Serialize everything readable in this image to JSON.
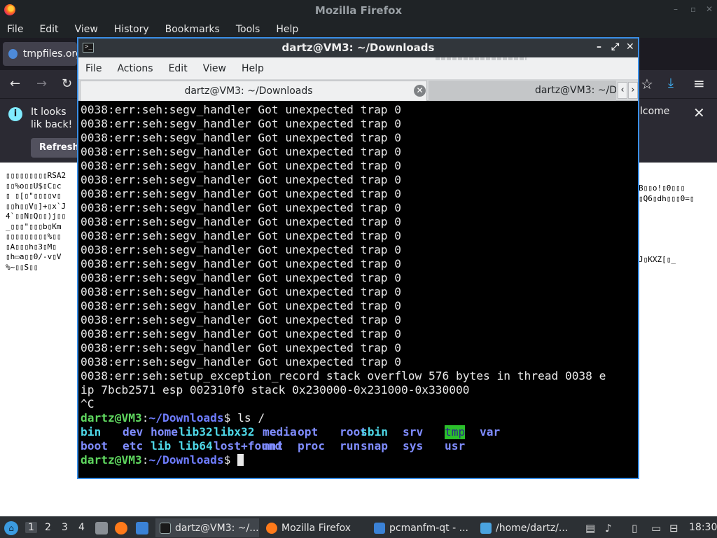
{
  "firefox": {
    "window_title": "Mozilla Firefox",
    "menu": [
      "File",
      "Edit",
      "View",
      "History",
      "Bookmarks",
      "Tools",
      "Help"
    ],
    "tab_label": "tmpfiles.org",
    "notice": {
      "message_left": "It looks lik back!",
      "message_right": "lcome",
      "refresh_label": "Refresh"
    },
    "garbled_left": "▯▯▯▯▯▯▯▯▯RSA2\n▯▯%o▯▯U$▯C▯c\n▯ ▯[▯\"▯▯▯▯v▯\n▯▯h▯▯V▯]+▯x`J\n4`▯▯N▯Q▯▯)j▯▯\n_▯▯▯\"▯▯▯b▯Km\n▯▯▯▯▯▯▯▯▯%▯▯\n▯A▯▯▯h▯3▯M▯\n▯h▭a▯▯0/-v▯V\n%~▯▯S▯▯",
    "garbled_right": "B▯▯o!▯0▯▯▯\n▯Q6▯dh▯▯▯0=▯\n\n\n\n\n\nJ▯KXZ[▯_"
  },
  "terminal": {
    "window_title": "dartz@VM3: ~/Downloads",
    "menu": [
      "File",
      "Actions",
      "Edit",
      "View",
      "Help"
    ],
    "tab_active": "dartz@VM3: ~/Downloads",
    "tab_inactive": "dartz@VM3: ~/Do",
    "output_lines": [
      "0038:err:seh:segv_handler Got unexpected trap 0",
      "0038:err:seh:segv_handler Got unexpected trap 0",
      "0038:err:seh:segv_handler Got unexpected trap 0",
      "0038:err:seh:segv_handler Got unexpected trap 0",
      "0038:err:seh:segv_handler Got unexpected trap 0",
      "0038:err:seh:segv_handler Got unexpected trap 0",
      "0038:err:seh:segv_handler Got unexpected trap 0",
      "0038:err:seh:segv_handler Got unexpected trap 0",
      "0038:err:seh:segv_handler Got unexpected trap 0",
      "0038:err:seh:segv_handler Got unexpected trap 0",
      "0038:err:seh:segv_handler Got unexpected trap 0",
      "0038:err:seh:segv_handler Got unexpected trap 0",
      "0038:err:seh:segv_handler Got unexpected trap 0",
      "0038:err:seh:segv_handler Got unexpected trap 0",
      "0038:err:seh:segv_handler Got unexpected trap 0",
      "0038:err:seh:segv_handler Got unexpected trap 0",
      "0038:err:seh:segv_handler Got unexpected trap 0",
      "0038:err:seh:segv_handler Got unexpected trap 0",
      "0038:err:seh:segv_handler Got unexpected trap 0",
      "0038:err:seh:setup_exception_record stack overflow 576 bytes in thread 0038 e",
      "ip 7bcb2571 esp 002310f0 stack 0x230000-0x231000-0x330000",
      "^C"
    ],
    "prompt_user": "dartz@VM3",
    "prompt_sep": ":",
    "prompt_path": "~/Downloads",
    "prompt_end": "$",
    "command": "ls /",
    "ls_row1": [
      {
        "name": "bin",
        "kind": "link"
      },
      {
        "name": "dev",
        "kind": "dir"
      },
      {
        "name": "home",
        "kind": "dir"
      },
      {
        "name": "lib32",
        "kind": "link"
      },
      {
        "name": "libx32",
        "kind": "link"
      },
      {
        "name": "media",
        "kind": "dir"
      },
      {
        "name": "opt",
        "kind": "dir"
      },
      {
        "name": "root",
        "kind": "dir"
      },
      {
        "name": "sbin",
        "kind": "link"
      },
      {
        "name": "srv",
        "kind": "dir"
      },
      {
        "name": "tmp",
        "kind": "tmp"
      },
      {
        "name": "var",
        "kind": "dir"
      }
    ],
    "ls_row2": [
      {
        "name": "boot",
        "kind": "dir"
      },
      {
        "name": "etc",
        "kind": "dir"
      },
      {
        "name": "lib",
        "kind": "link"
      },
      {
        "name": "lib64",
        "kind": "link"
      },
      {
        "name": "lost+found",
        "kind": "dir"
      },
      {
        "name": "mnt",
        "kind": "dir"
      },
      {
        "name": "proc",
        "kind": "dir"
      },
      {
        "name": "run",
        "kind": "dir"
      },
      {
        "name": "snap",
        "kind": "dir"
      },
      {
        "name": "sys",
        "kind": "dir"
      },
      {
        "name": "usr",
        "kind": "dir"
      }
    ]
  },
  "taskbar": {
    "desktops": [
      "1",
      "2",
      "3",
      "4"
    ],
    "tasks": [
      {
        "label": "dartz@VM3: ~/...",
        "icon": "terminal-icon",
        "color": "#3a3f44"
      },
      {
        "label": "Mozilla Firefox",
        "icon": "firefox-icon",
        "color": "#ff7a1a"
      },
      {
        "label": "pcmanfm-qt - ...",
        "icon": "folder-icon",
        "color": "#3b82d6"
      },
      {
        "label": "/home/dartz/...",
        "icon": "image-viewer-icon",
        "color": "#4aa3df"
      }
    ],
    "clock": "18:30"
  },
  "colors": {
    "terminal_bg": "#000000",
    "prompt_user": "#5fd75f",
    "prompt_path": "#6f7dff",
    "accent_border": "#3a8ee6"
  }
}
